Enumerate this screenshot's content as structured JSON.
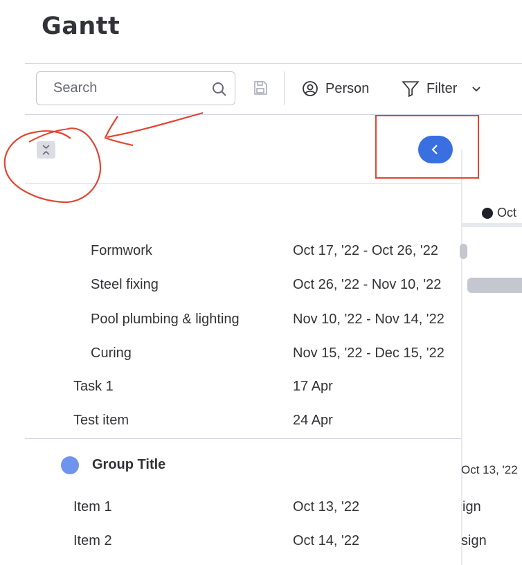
{
  "header": {
    "title": "Gantt"
  },
  "toolbar": {
    "search_placeholder": "Search",
    "person_label": "Person",
    "filter_label": "Filter"
  },
  "timeline": {
    "month_label": "Oct",
    "group_date_label": "Oct 13, '22",
    "item_fragments": [
      "ign",
      "sign"
    ]
  },
  "rows": [
    {
      "name": "Formwork",
      "date": "Oct 17, '22 - Oct 26, '22"
    },
    {
      "name": "Steel fixing",
      "date": "Oct 26, '22 - Nov 10, '22"
    },
    {
      "name": "Pool plumbing & lighting",
      "date": "Nov 10, '22 - Nov 14, '22"
    },
    {
      "name": "Curing",
      "date": "Nov 15, '22 - Dec 15, '22"
    },
    {
      "name": "Task 1",
      "date": "17 Apr"
    },
    {
      "name": "Test item",
      "date": "24 Apr"
    }
  ],
  "group": {
    "title": "Group Title",
    "color": "#6f94ee",
    "items": [
      {
        "name": "Item 1",
        "date": "Oct 13, '22"
      },
      {
        "name": "Item 2",
        "date": "Oct 14, '22"
      }
    ]
  },
  "colors": {
    "accent": "#3a6fe0",
    "annotation_red": "#e2442f",
    "bar_gray": "#c5c7d0"
  }
}
